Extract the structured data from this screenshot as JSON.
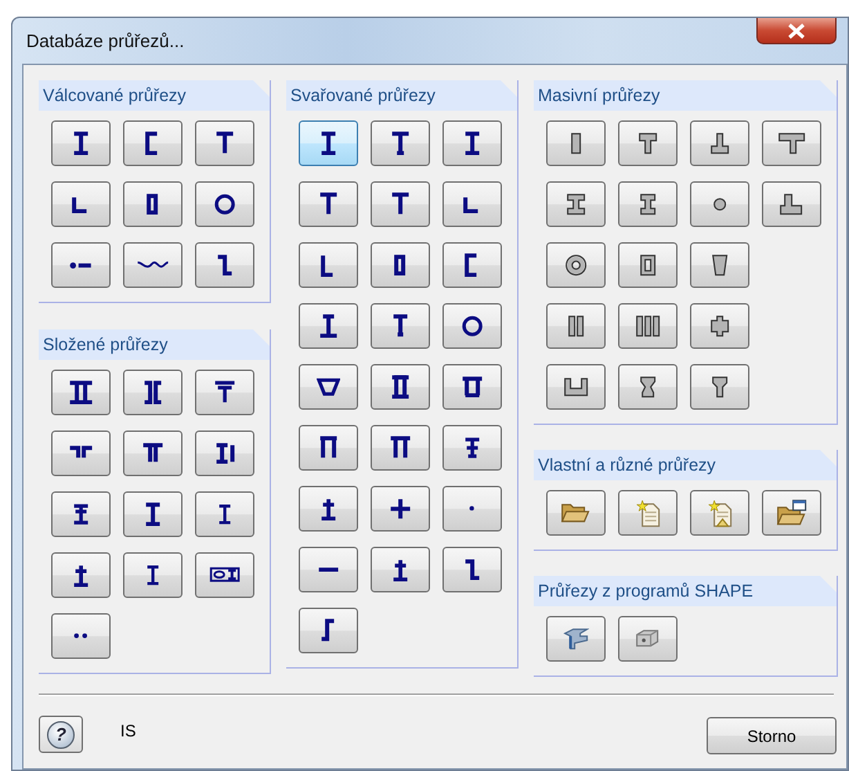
{
  "window": {
    "title": "Databáze průřezů..."
  },
  "columns": [
    {
      "groups": [
        {
          "title": "Válcované průřezy",
          "buttons": [
            {
              "kind": "ibeam",
              "selected": false
            },
            {
              "kind": "channel",
              "selected": false
            },
            {
              "kind": "tee",
              "selected": false
            },
            {
              "kind": "angle",
              "selected": false
            },
            {
              "kind": "rhs",
              "selected": false
            },
            {
              "kind": "chs",
              "selected": false
            },
            {
              "kind": "roundbar",
              "selected": false
            },
            {
              "kind": "sheetpile",
              "selected": false
            },
            {
              "kind": "zed",
              "selected": false
            }
          ]
        },
        {
          "title": "Složené průřezy",
          "buttons": [
            {
              "kind": "doublei",
              "selected": false
            },
            {
              "kind": "backchannel",
              "selected": false
            },
            {
              "kind": "teeflange",
              "selected": false
            },
            {
              "kind": "doubleangle",
              "selected": false
            },
            {
              "kind": "doubletee",
              "selected": false
            },
            {
              "kind": "iplate",
              "selected": false
            },
            {
              "kind": "iplates",
              "selected": false
            },
            {
              "kind": "ibeam",
              "selected": false
            },
            {
              "kind": "ismall",
              "selected": false
            },
            {
              "kind": "iup",
              "selected": false
            },
            {
              "kind": "ismall",
              "selected": false
            },
            {
              "kind": "tubei",
              "selected": false
            },
            {
              "kind": "twodots",
              "selected": false
            }
          ]
        }
      ]
    },
    {
      "groups": [
        {
          "title": "Svařované průřezy",
          "buttons": [
            {
              "kind": "ibeam",
              "selected": true
            },
            {
              "kind": "ibeamtop",
              "selected": false
            },
            {
              "kind": "ibeam",
              "selected": false
            },
            {
              "kind": "tee",
              "selected": false
            },
            {
              "kind": "tee",
              "selected": false
            },
            {
              "kind": "angle",
              "selected": false
            },
            {
              "kind": "angleeq",
              "selected": false
            },
            {
              "kind": "rhs",
              "selected": false
            },
            {
              "kind": "channel",
              "selected": false
            },
            {
              "kind": "ibeamasym",
              "selected": false
            },
            {
              "kind": "teewide",
              "selected": false
            },
            {
              "kind": "chs",
              "selected": false
            },
            {
              "kind": "trianglebox",
              "selected": false
            },
            {
              "kind": "boxflange",
              "selected": false
            },
            {
              "kind": "hatbox",
              "selected": false
            },
            {
              "kind": "pi",
              "selected": false
            },
            {
              "kind": "pi2",
              "selected": false
            },
            {
              "kind": "icross",
              "selected": false
            },
            {
              "kind": "iup",
              "selected": false
            },
            {
              "kind": "cross",
              "selected": false
            },
            {
              "kind": "dot",
              "selected": false
            },
            {
              "kind": "flat",
              "selected": false
            },
            {
              "kind": "iup",
              "selected": false
            },
            {
              "kind": "zed",
              "selected": false
            },
            {
              "kind": "sshape",
              "selected": false
            }
          ]
        }
      ]
    },
    {
      "groups": [
        {
          "title": "Masivní průřezy",
          "buttons": [
            {
              "kind": "solidrect",
              "selected": false
            },
            {
              "kind": "solidtee",
              "selected": false
            },
            {
              "kind": "solidinvtee",
              "selected": false
            },
            {
              "kind": "solidteewide",
              "selected": false
            },
            {
              "kind": "solidi",
              "selected": false
            },
            {
              "kind": "solidi2",
              "selected": false
            },
            {
              "kind": "solidcircle",
              "selected": false
            },
            {
              "kind": "solidinvteewide",
              "selected": false
            },
            {
              "kind": "ring",
              "selected": false
            },
            {
              "kind": "hollowrect",
              "selected": false
            },
            {
              "kind": "trapezoid",
              "selected": false
            },
            {
              "kind": "doublerect",
              "selected": false
            },
            {
              "kind": "triplerect",
              "selected": false
            },
            {
              "kind": "crossrect",
              "selected": false
            },
            {
              "kind": "usolid",
              "selected": false
            },
            {
              "kind": "hourglass",
              "selected": false
            },
            {
              "kind": "yshape",
              "selected": false
            }
          ]
        },
        {
          "title": "Vlastní a různé průřezy",
          "buttons": [
            {
              "kind": "folder",
              "selected": false
            },
            {
              "kind": "newfile",
              "selected": false
            },
            {
              "kind": "importfile",
              "selected": false
            },
            {
              "kind": "folderwin",
              "selected": false
            }
          ]
        },
        {
          "title": "Průřezy z programů SHAPE",
          "buttons": [
            {
              "kind": "shapethin",
              "selected": false
            },
            {
              "kind": "shapemassive",
              "selected": false
            }
          ]
        }
      ]
    }
  ],
  "footer": {
    "help_glyph": "?",
    "label": "IS",
    "cancel_button": "Storno"
  }
}
